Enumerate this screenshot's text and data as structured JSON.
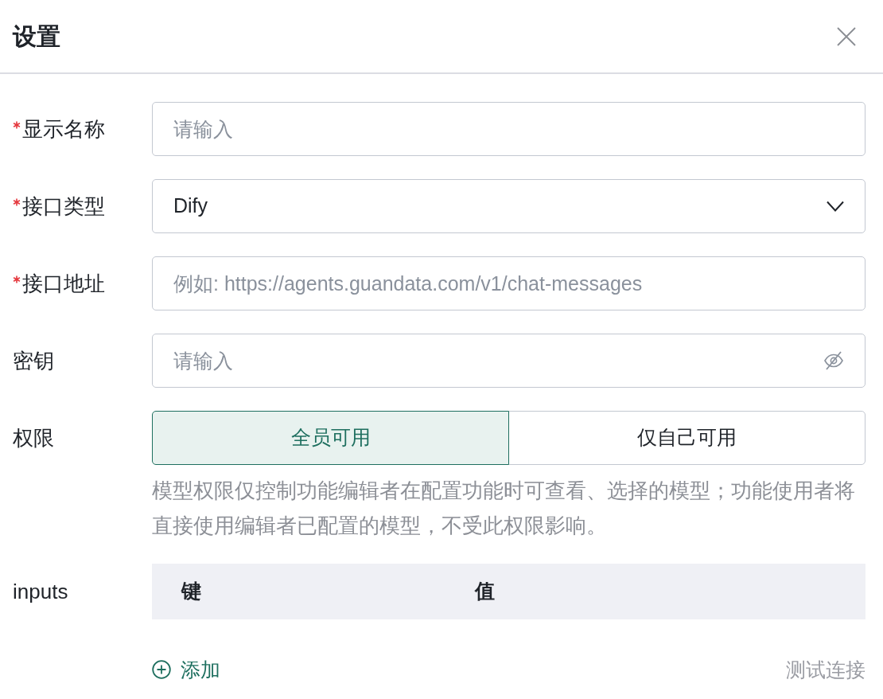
{
  "dialog": {
    "title": "设置"
  },
  "fields": [
    {
      "kind": "text",
      "label": "显示名称",
      "required": true,
      "placeholder": "请输入"
    },
    {
      "kind": "select",
      "label": "接口类型",
      "required": true,
      "value": "Dify"
    },
    {
      "kind": "text",
      "label": "接口地址",
      "required": true,
      "placeholder": "例如: https://agents.guandata.com/v1/chat-messages"
    },
    {
      "kind": "password",
      "label": "密钥",
      "required": false,
      "placeholder": "请输入"
    },
    {
      "kind": "segmented",
      "label": "权限",
      "required": false,
      "options": [
        {
          "label": "全员可用",
          "selected": true
        },
        {
          "label": "仅自己可用",
          "selected": false
        }
      ],
      "help": "模型权限仅控制功能编辑者在配置功能时可查看、选择的模型；功能使用者将直接使用编辑者已配置的模型，不受此权限影响。"
    }
  ],
  "inputs_table": {
    "label": "inputs",
    "columns": [
      "键",
      "值"
    ]
  },
  "footer": {
    "add_button": "添加",
    "test_button": "测试连接"
  }
}
